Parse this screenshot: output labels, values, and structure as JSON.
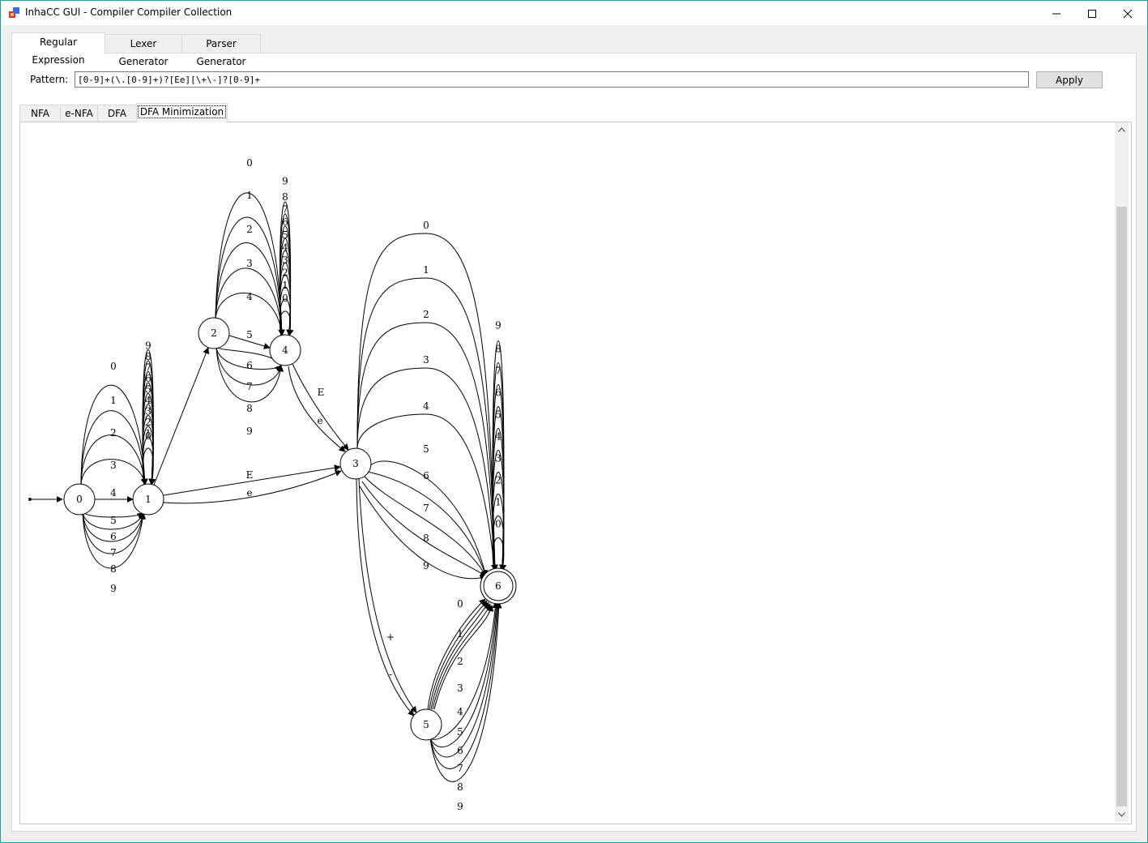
{
  "window": {
    "title": "InhaCC GUI - Compiler Compiler Collection",
    "buttons": [
      "minimize",
      "maximize",
      "close"
    ]
  },
  "main_tabs": [
    {
      "label": "Regular Expression",
      "active": true
    },
    {
      "label": "Lexer Generator",
      "active": false
    },
    {
      "label": "Parser Generator",
      "active": false
    }
  ],
  "pattern": {
    "label": "Pattern:",
    "value": "[0-9]+(\\.[0-9]+)?[Ee][\\+\\-]?[0-9]+",
    "apply_label": "Apply"
  },
  "sub_tabs": [
    {
      "label": "NFA",
      "active": false
    },
    {
      "label": "e-NFA",
      "active": false
    },
    {
      "label": "DFA",
      "active": false
    },
    {
      "label": "DFA Minimization",
      "active": true
    }
  ],
  "graph": {
    "start_state": "0",
    "accepting_states": [
      "6"
    ],
    "states": [
      "0",
      "1",
      "2",
      "3",
      "4",
      "5",
      "6"
    ],
    "digits": [
      "0",
      "1",
      "2",
      "3",
      "4",
      "5",
      "6",
      "7",
      "8",
      "9"
    ],
    "transitions": [
      {
        "from": "0",
        "to": "1",
        "labels": [
          "0",
          "1",
          "2",
          "3",
          "4",
          "5",
          "6",
          "7",
          "8",
          "9"
        ]
      },
      {
        "from": "1",
        "to": "1",
        "labels": [
          "0",
          "1",
          "2",
          "3",
          "4",
          "5",
          "6",
          "7",
          "8",
          "9"
        ]
      },
      {
        "from": "1",
        "to": "2",
        "labels": []
      },
      {
        "from": "1",
        "to": "3",
        "labels": [
          "E",
          "e"
        ]
      },
      {
        "from": "2",
        "to": "4",
        "labels": [
          "0",
          "1",
          "2",
          "3",
          "4",
          "5",
          "6",
          "7",
          "8",
          "9"
        ]
      },
      {
        "from": "4",
        "to": "4",
        "labels": [
          "0",
          "1",
          "2",
          "3",
          "4",
          "5",
          "6",
          "7",
          "8",
          "9"
        ]
      },
      {
        "from": "4",
        "to": "3",
        "labels": [
          "E",
          "e"
        ]
      },
      {
        "from": "3",
        "to": "6",
        "labels": [
          "0",
          "1",
          "2",
          "3",
          "4",
          "5",
          "6",
          "7",
          "8",
          "9"
        ]
      },
      {
        "from": "3",
        "to": "5",
        "labels": [
          "+",
          "-"
        ]
      },
      {
        "from": "5",
        "to": "6",
        "labels": [
          "0",
          "1",
          "2",
          "3",
          "4",
          "5",
          "6",
          "7",
          "8",
          "9"
        ]
      },
      {
        "from": "6",
        "to": "6",
        "labels": [
          "0",
          "1",
          "2",
          "3",
          "4",
          "5",
          "6",
          "7",
          "8",
          "9"
        ]
      }
    ]
  }
}
